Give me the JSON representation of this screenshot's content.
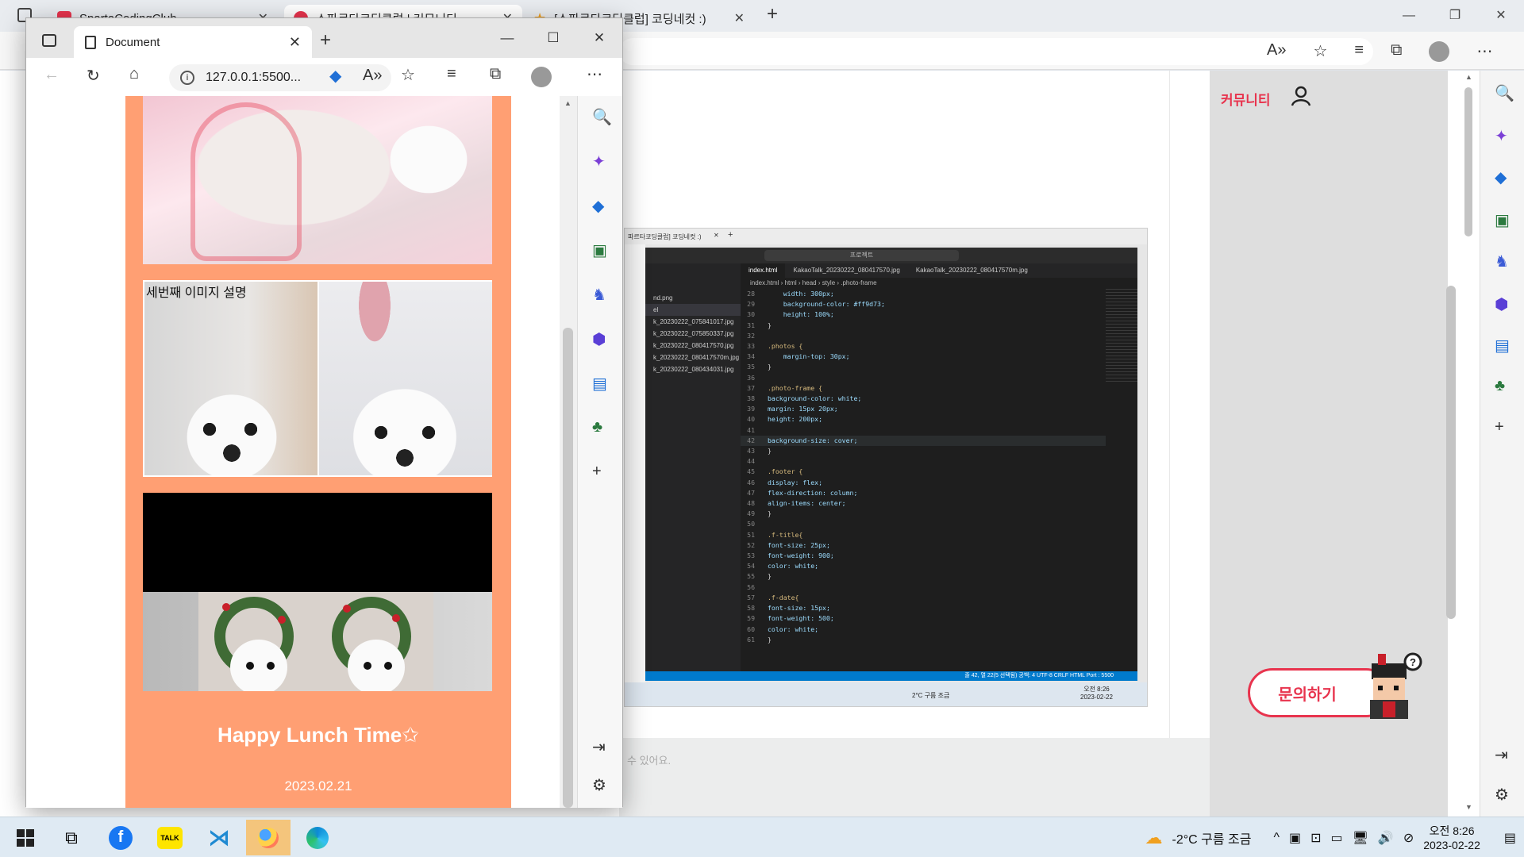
{
  "background_browser": {
    "tabs": [
      {
        "label": "SpartaCodingClub",
        "color": "#e8344e"
      },
      {
        "label": "스파르타코딩클럽 | 커뮤니티",
        "color": "#e8344e"
      },
      {
        "label": "[스파르타코딩클럽] 코딩네컷 :)",
        "color": "#f0a020"
      }
    ],
    "community_link": "커뮤니티",
    "inquiry_button": "문의하기",
    "faint_text": "수 있어요.",
    "sidebar_icons": [
      "search-icon",
      "sparkle-icon",
      "tag-icon",
      "toolbox-icon",
      "chess-icon",
      "office-icon",
      "outlook-icon",
      "tree-icon",
      "plus-icon",
      "split-icon",
      "gear-icon"
    ]
  },
  "embedded_screenshot": {
    "tab_label": "파르타코딩클럽] 코딩네컷 :)",
    "search_label": "프로젝트",
    "explorer_files": [
      "nd.png",
      "el",
      "k_20230222_075841017.jpg",
      "k_20230222_075850337.jpg",
      "k_20230222_080417570.jpg",
      "k_20230222_080417570m.jpg",
      "k_20230222_080434031.jpg"
    ],
    "editor_tabs": [
      "index.html",
      "KakaoTalk_20230222_080417570.jpg",
      "KakaoTalk_20230222_080417570m.jpg"
    ],
    "breadcrumb": "index.html › html › head › style › .photo-frame",
    "code_lines": [
      {
        "n": "28",
        "t": "    width: 300px;",
        "k": "prop"
      },
      {
        "n": "29",
        "t": "    background-color: #ff9d73;",
        "k": "prop"
      },
      {
        "n": "30",
        "t": "    height: 100%;",
        "k": "prop"
      },
      {
        "n": "31",
        "t": "}",
        "k": ""
      },
      {
        "n": "32",
        "t": "",
        "k": ""
      },
      {
        "n": "33",
        "t": ".photos {",
        "k": "sel"
      },
      {
        "n": "34",
        "t": "    margin-top: 30px;",
        "k": "prop"
      },
      {
        "n": "35",
        "t": "}",
        "k": ""
      },
      {
        "n": "36",
        "t": "",
        "k": ""
      },
      {
        "n": "37",
        "t": ".photo-frame {",
        "k": "sel"
      },
      {
        "n": "38",
        "t": "background-color: white;",
        "k": "prop"
      },
      {
        "n": "39",
        "t": "margin: 15px 20px;",
        "k": "prop"
      },
      {
        "n": "40",
        "t": "height: 200px;",
        "k": "prop"
      },
      {
        "n": "41",
        "t": "",
        "k": ""
      },
      {
        "n": "42",
        "t": "background-size: cover;",
        "k": "prop"
      },
      {
        "n": "43",
        "t": "}",
        "k": ""
      },
      {
        "n": "44",
        "t": "",
        "k": ""
      },
      {
        "n": "45",
        "t": ".footer {",
        "k": "sel"
      },
      {
        "n": "46",
        "t": "display: flex;",
        "k": "prop"
      },
      {
        "n": "47",
        "t": "flex-direction: column;",
        "k": "prop"
      },
      {
        "n": "48",
        "t": "align-items: center;",
        "k": "prop"
      },
      {
        "n": "49",
        "t": "}",
        "k": ""
      },
      {
        "n": "50",
        "t": "",
        "k": ""
      },
      {
        "n": "51",
        "t": ".f-title{",
        "k": "sel"
      },
      {
        "n": "52",
        "t": "font-size: 25px;",
        "k": "prop"
      },
      {
        "n": "53",
        "t": "font-weight: 900;",
        "k": "prop"
      },
      {
        "n": "54",
        "t": "color: white;",
        "k": "prop"
      },
      {
        "n": "55",
        "t": "}",
        "k": ""
      },
      {
        "n": "56",
        "t": "",
        "k": ""
      },
      {
        "n": "57",
        "t": ".f-date{",
        "k": "sel"
      },
      {
        "n": "58",
        "t": "font-size: 15px;",
        "k": "prop"
      },
      {
        "n": "59",
        "t": "font-weight: 500;",
        "k": "prop"
      },
      {
        "n": "60",
        "t": "color: white;",
        "k": "prop"
      },
      {
        "n": "61",
        "t": "}",
        "k": ""
      }
    ],
    "status_bar": "줄 42, 열 22(5 선택됨)   공백: 4   UTF-8   CRLF   HTML   Port : 5500",
    "taskbar_weather": "2°C 구름 조금",
    "taskbar_time": "오전 8:26",
    "taskbar_date": "2023-02-22"
  },
  "foreground_window": {
    "tab_title": "Document",
    "address": "127.0.0.1:5500...",
    "page": {
      "caption": "세번째 이미지 설명",
      "footer_title": "Happy Lunch Time✩",
      "footer_date": "2023.02.21",
      "frame_color": "#ff9f73"
    }
  },
  "taskbar": {
    "apps": [
      "windows-start-icon",
      "task-view-icon",
      "facebook-icon",
      "kakaotalk-icon",
      "vscode-icon",
      "photos-icon",
      "edge-icon"
    ],
    "kakao_label": "TALK",
    "weather": "-2°C  구름 조금",
    "time": "오전 8:26",
    "date": "2023-02-22"
  }
}
